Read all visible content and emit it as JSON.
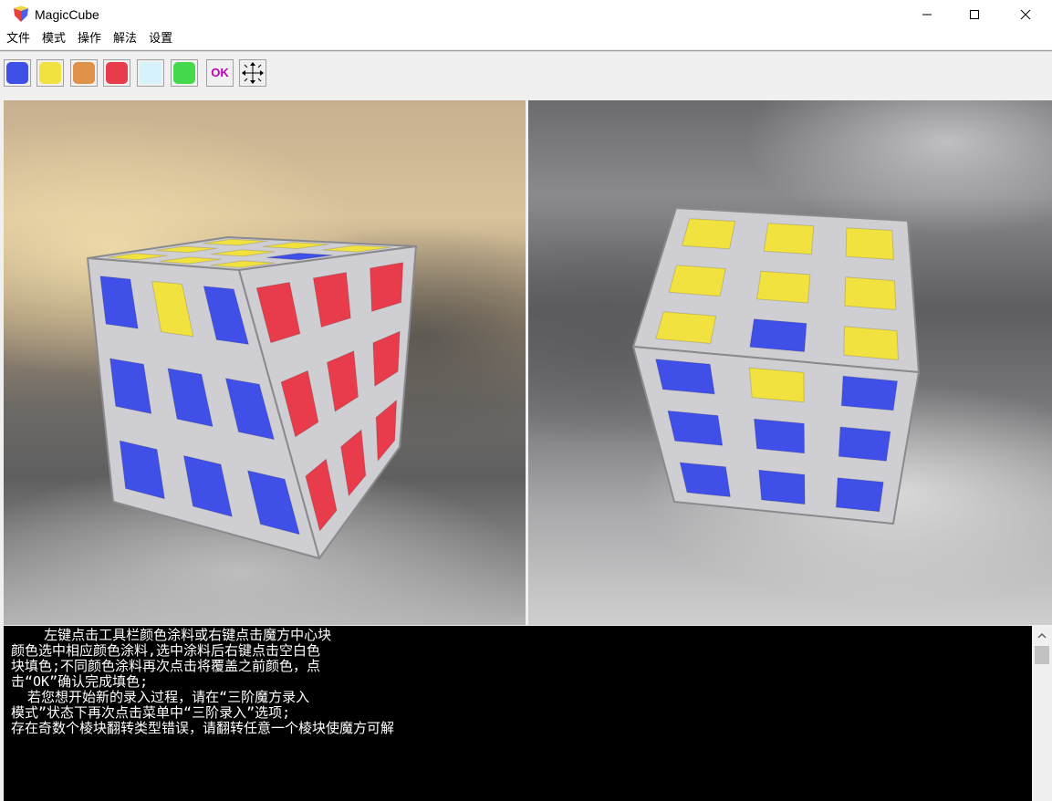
{
  "window": {
    "title": "MagicCube"
  },
  "menu": {
    "items": [
      "文件",
      "模式",
      "操作",
      "解法",
      "设置"
    ]
  },
  "toolbar": {
    "colors": [
      "#3f4fe8",
      "#f2e23f",
      "#e0914a",
      "#e83c4c",
      "#d6f3fb",
      "#44d84c"
    ],
    "ok_label": "OK",
    "move_icon": "move-arrows-icon"
  },
  "cube_colors": {
    "blue": "#3f4fe8",
    "yellow": "#f2e23f",
    "red": "#e83c4c"
  },
  "console": {
    "lines": [
      "    左键点击工具栏颜色涂料或右键点击魔方中心块",
      "颜色选中相应颜色涂料,选中涂料后右键点击空白色",
      "块填色;不同颜色涂料再次点击将覆盖之前颜色，点",
      "击“OK”确认完成填色;",
      "  若您想开始新的录入过程，请在“三阶魔方录入",
      "模式”状态下再次点击菜单中“三阶录入”选项;",
      "存在奇数个棱块翻转类型错误，请翻转任意一个棱块使魔方可解"
    ]
  }
}
